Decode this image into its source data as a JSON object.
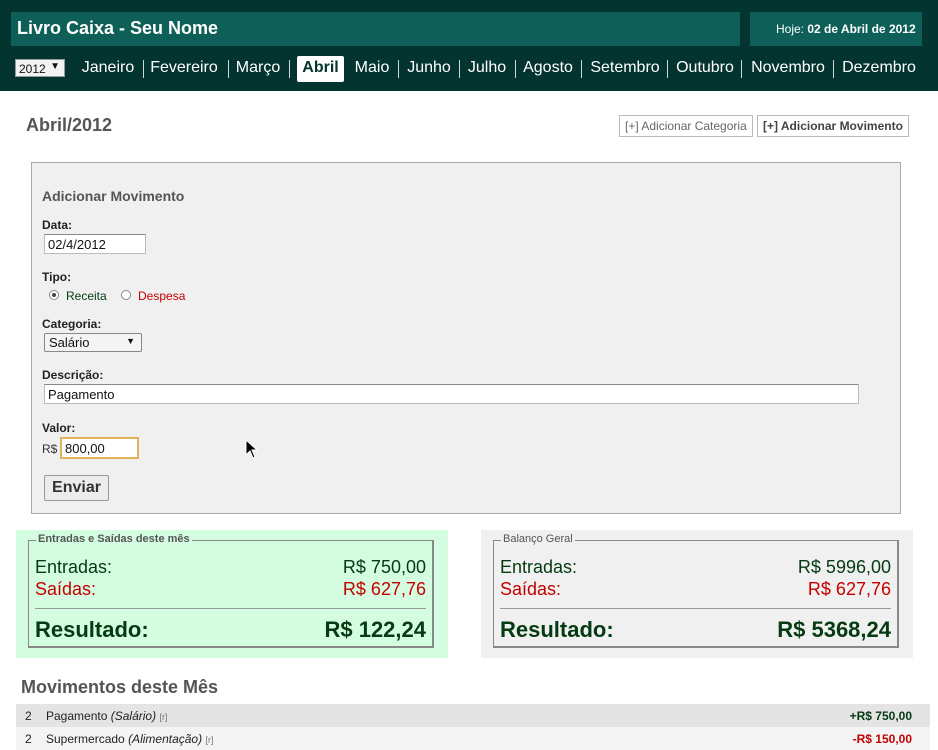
{
  "header": {
    "app_title": "Livro Caixa - Seu Nome",
    "today_label": "Hoje:",
    "today_value": "02 de Abril de 2012",
    "year": "2012",
    "months": [
      "Janeiro",
      "Fevereiro",
      "Março",
      "Abril",
      "Maio",
      "Junho",
      "Julho",
      "Agosto",
      "Setembro",
      "Outubro",
      "Novembro",
      "Dezembro"
    ],
    "active_month": "Abril"
  },
  "page": {
    "title": "Abril/2012",
    "add_category_label": "[+] Adicionar Categoria",
    "add_movement_label": "[+] Adicionar Movimento"
  },
  "form": {
    "title": "Adicionar Movimento",
    "date_label": "Data:",
    "date_value": "02/4/2012",
    "type_label": "Tipo:",
    "type_income": "Receita",
    "type_expense": "Despesa",
    "type_selected": "Receita",
    "category_label": "Categoria:",
    "category_value": "Salário",
    "description_label": "Descrição:",
    "description_value": "Pagamento",
    "value_label": "Valor:",
    "currency": "R$",
    "value": "800,00",
    "submit_label": "Enviar"
  },
  "month_summary": {
    "legend": "Entradas e Saídas deste mês",
    "income_label": "Entradas:",
    "income_value": "R$ 750,00",
    "expense_label": "Saídas:",
    "expense_value": "R$ 627,76",
    "result_label": "Resultado:",
    "result_value": "R$ 122,24"
  },
  "general_balance": {
    "legend": "Balanço Geral",
    "income_label": "Entradas:",
    "income_value": "R$ 5996,00",
    "expense_label": "Saídas:",
    "expense_value": "R$ 627,76",
    "result_label": "Resultado:",
    "result_value": "R$ 5368,24"
  },
  "movements": {
    "title": "Movimentos deste Mês",
    "rows": [
      {
        "day": "2",
        "description": "Pagamento",
        "category": "(Salário)",
        "edit": "[r]",
        "amount": "+R$ 750,00",
        "kind": "pos"
      },
      {
        "day": "2",
        "description": "Supermercado",
        "category": "(Alimentação)",
        "edit": "[r]",
        "amount": "-R$ 150,00",
        "kind": "neg"
      }
    ]
  },
  "colors": {
    "header_dark": "#04342f",
    "header_teal": "#0d5f57",
    "income_green": "#053a12",
    "expense_red": "#c40000",
    "month_summary_bg": "#d3fce0",
    "balance_bg": "#f0f0f0"
  }
}
